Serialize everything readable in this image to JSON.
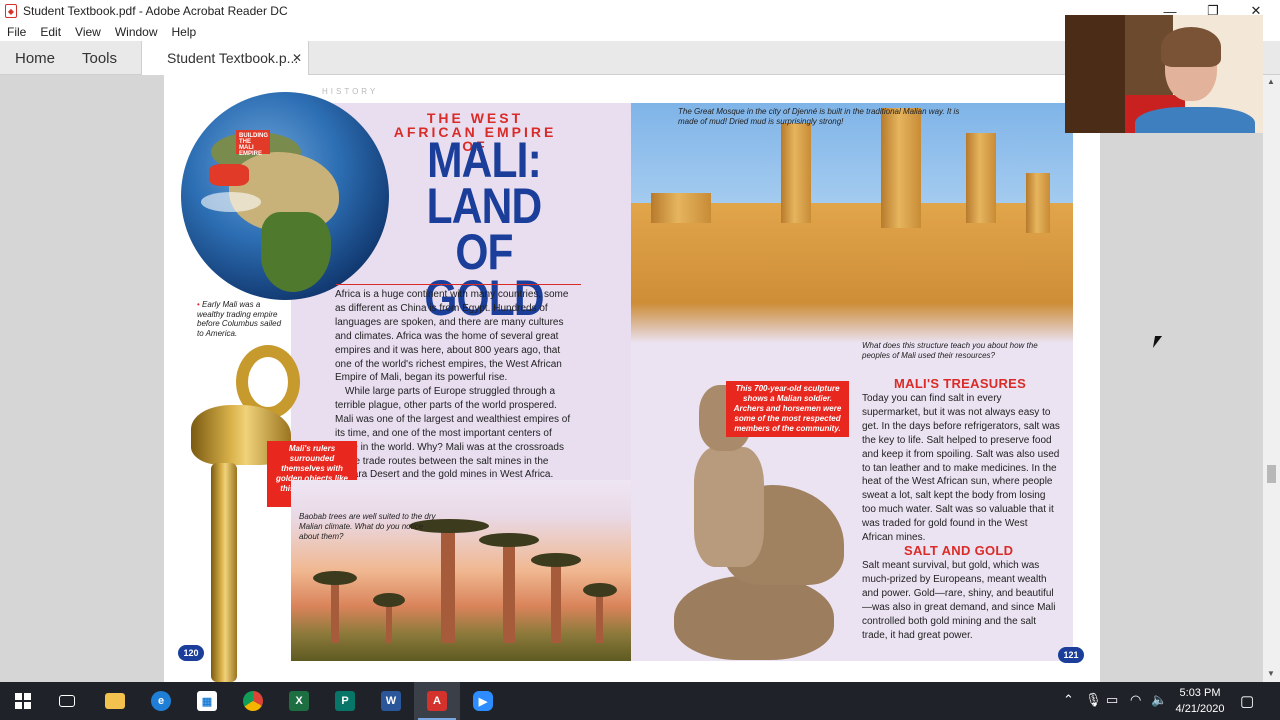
{
  "window": {
    "title": "Student Textbook.pdf - Adobe Acrobat Reader DC",
    "controls": {
      "minimize": "—",
      "restore": "❐",
      "close": "✕"
    }
  },
  "menu": [
    "File",
    "Edit",
    "View",
    "Window",
    "Help"
  ],
  "tabs": {
    "home": "Home",
    "tools": "Tools",
    "document": "Student Textbook.p...",
    "close": "✕"
  },
  "spread": {
    "section_label": "HISTORY",
    "subhead": "THE WEST AFRICAN EMPIRE OF",
    "headline": [
      "MALI:",
      "LAND OF",
      "GOLD"
    ],
    "globe_flag": "BUILDING THE MALI EMPIRE",
    "early_caption": "Early Mali was a wealthy trading empire before Columbus sailed to America.",
    "intro_p1": "Africa is a huge continent with many countries, some as different as China is from Egypt. Hundreds of languages are spoken, and there are many cultures and climates. Africa was the home of several great empires and it was here, about 800 years ago, that one of the world's richest empires, the West African Empire of Mali, began its powerful rise.",
    "intro_p2": "While large parts of Europe struggled through a terrible plague, other parts of the world prospered. Mali was one of the largest and wealthiest empires of its time, and one of the most important centers of trade in the world. Why? Mali was at the crossroads of the trade routes between the salt mines in the Sahara Desert and the gold mines in West Africa.",
    "rulers_caption": "Mali's rulers surrounded themselves with golden objects like this bracelet and staff.",
    "baobab_caption": "Baobab trees are well suited to the dry Malian climate. What do you notice about them?",
    "mosque_caption": "The Great Mosque in the city of Djenné is built in the traditional Malian way. It is made of mud! Dried mud is surprisingly strong!",
    "structure_question": "What does this structure teach you about how the peoples of Mali used their resources?",
    "soldier_caption": "This 700-year-old sculpture shows a Malian soldier. Archers and horsemen were some of the most respected members of the community.",
    "treasures_heading": "MALI'S TREASURES",
    "treasures_body": "Today you can find salt in every supermarket, but it was not always easy to get. In the days before refrigerators, salt was the key to life. Salt helped to preserve food and keep it from spoiling. Salt was also used to tan leather and to make medicines. In the heat of the West African sun, where people sweat a lot, salt kept the body from losing too much water. Salt was so valuable that it was traded for gold found in the West African mines.",
    "salt_heading": "SALT AND GOLD",
    "salt_body": "Salt meant survival, but gold, which was much-prized by Europeans, meant wealth and power. Gold—rare, shiny, and beautiful—was also in great demand, and since Mali controlled both gold mining and the salt trade, it had great power.",
    "page_left": "120",
    "page_right": "121"
  },
  "taskbar": {
    "apps": [
      "windows-start",
      "task-view",
      "file-explorer",
      "edge",
      "store",
      "chrome",
      "excel",
      "publisher",
      "word",
      "acrobat",
      "zoom"
    ],
    "clock_time": "5:03 PM",
    "clock_date": "4/21/2020"
  },
  "colors": {
    "accent_red": "#d92c28",
    "headline_blue": "#1a3e9a",
    "taskbar": "#1f2228"
  }
}
